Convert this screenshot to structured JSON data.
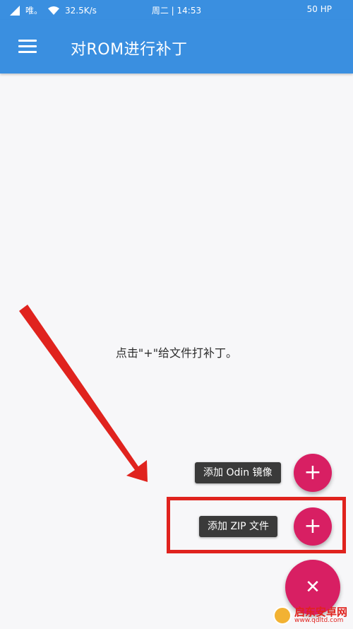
{
  "status_bar": {
    "carrier": "唯。",
    "network_speed": "32.5K/s",
    "time": "周二 | 14:53",
    "battery": "50 HP"
  },
  "app_bar": {
    "menu_icon": "hamburger-menu-icon",
    "title": "对ROM进行补丁"
  },
  "main": {
    "hint": "点击\"+\"给文件打补丁。"
  },
  "fab_menu": {
    "items": [
      {
        "label": "添加 Odin 镜像",
        "icon": "plus-icon"
      },
      {
        "label": "添加 ZIP 文件",
        "icon": "plus-icon"
      }
    ],
    "main_icon": "close-icon",
    "accent_color": "#d81f63"
  },
  "annotation": {
    "arrow_color": "#e0231e",
    "highlight_color": "#e0231e"
  },
  "watermark": {
    "main": "启东安卓网",
    "sub": "www.qdltd.com"
  },
  "colors": {
    "primary": "#3a8fe0",
    "background": "#f7f7f9"
  }
}
